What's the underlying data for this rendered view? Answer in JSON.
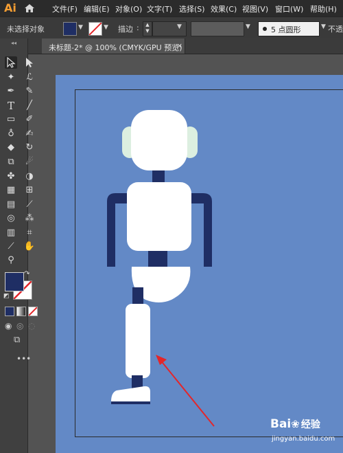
{
  "app": {
    "logo": "Ai"
  },
  "menu": {
    "items": [
      "文件(F)",
      "编辑(E)",
      "对象(O)",
      "文字(T)",
      "选择(S)",
      "效果(C)",
      "视图(V)",
      "窗口(W)",
      "帮助(H)"
    ]
  },
  "controlbar": {
    "selection_status": "未选择对象",
    "stroke_label": "描边",
    "stroke_colon": ":",
    "brush_value": "5 点圆形",
    "opacity_label": "不透明"
  },
  "colors": {
    "fill": "#1f2e64",
    "canvas": "#6389c6",
    "robot_white": "#ffffff",
    "robot_dark": "#1f2e64",
    "ears": "#dcefe0",
    "arrow": "#e3262a"
  },
  "document": {
    "tab_title": "未标题-2* @ 100% (CMYK/GPU 预览)",
    "close_glyph": "×"
  },
  "tools": [
    "selection-tool",
    "direct-selection-tool",
    "magic-wand-tool",
    "lasso-tool",
    "pen-tool",
    "curvature-tool",
    "type-tool",
    "line-tool",
    "rectangle-tool",
    "paintbrush-tool",
    "shaper-tool",
    "blob-brush-tool",
    "eraser-tool",
    "rotate-tool",
    "scale-tool",
    "warp-tool",
    "free-transform-tool",
    "shape-builder-tool",
    "perspective-tool",
    "mesh-tool",
    "gradient-tool",
    "eyedropper-tool",
    "blend-tool",
    "symbol-sprayer-tool",
    "column-graph-tool",
    "artboard-tool",
    "slice-tool",
    "hand-tool",
    "zoom-tool"
  ],
  "watermark": {
    "brand": "Bai",
    "brand_suffix": "经验",
    "url": "jingyan.baidu.com"
  }
}
